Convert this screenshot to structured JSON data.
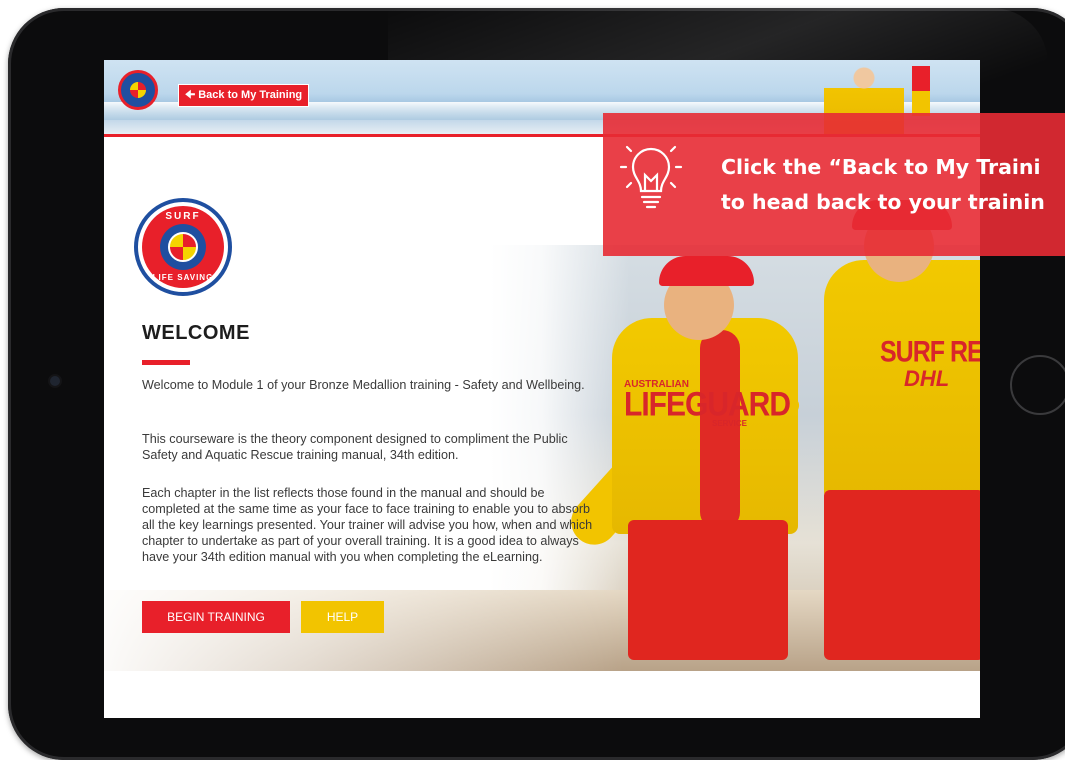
{
  "header": {
    "back_button_label": "Back to My Training"
  },
  "logo": {
    "top_text": "SURF",
    "bottom_text": "LIFE SAVING"
  },
  "hero": {
    "guard1_shirt_small": "AUSTRALIAN",
    "guard1_shirt_big": "LIFEGUARD",
    "guard1_shirt_tiny": "SERVICE",
    "guard2_shirt": "SURF RESCUE",
    "guard2_sponsor": "DHL"
  },
  "main": {
    "title": "WELCOME",
    "paragraphs": [
      "Welcome to Module 1 of your Bronze Medallion training - Safety and Wellbeing.",
      "This courseware is the theory component designed to compliment the Public Safety and Aquatic Rescue training manual, 34th edition.",
      "Each chapter in the list reflects those found in the manual and should be completed at the same time as your face to face training to enable you to absorb all the key learnings presented. Your trainer will advise you how, when and which chapter to undertake as part of your overall training. It is a good idea to always have your 34th edition manual with you when completing the eLearning."
    ],
    "begin_button_label": "BEGIN TRAINING",
    "help_button_label": "HELP"
  },
  "tooltip": {
    "line1": "Click the “Back to My Traini",
    "line2": "to head back to your trainin"
  },
  "colors": {
    "brand_red": "#e8202a",
    "brand_yellow": "#f2c400",
    "brand_blue": "#1f4fa0"
  },
  "icons": {
    "tooltip": "lightbulb-icon",
    "back": "arrow-left-icon"
  }
}
